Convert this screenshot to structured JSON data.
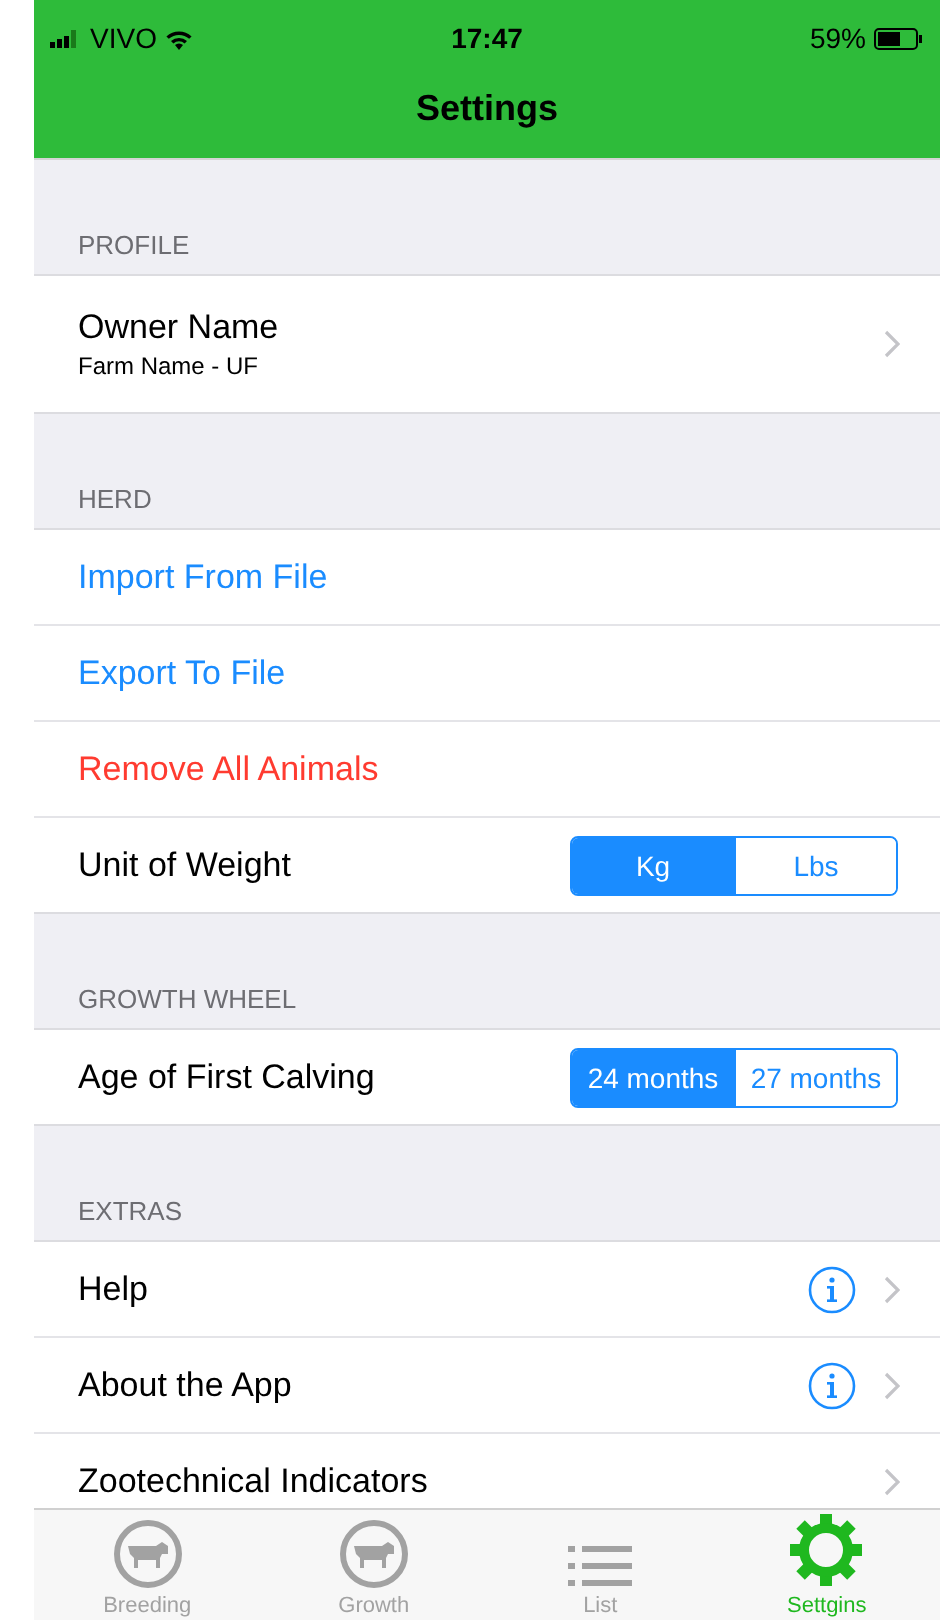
{
  "status_bar": {
    "carrier": "VIVO",
    "time": "17:47",
    "battery": "59%"
  },
  "nav_bar": {
    "title": "Settings"
  },
  "sections": [
    {
      "header": "PROFILE",
      "rows": [
        {
          "kind": "detail",
          "title": "Owner Name",
          "subtitle": "Farm Name - UF"
        }
      ]
    },
    {
      "header": "HERD",
      "rows": [
        {
          "kind": "link",
          "title": "Import From File"
        },
        {
          "kind": "link",
          "title": "Export To File"
        },
        {
          "kind": "destructive",
          "title": "Remove All Animals"
        },
        {
          "kind": "segment",
          "title": "Unit of Weight",
          "options": [
            {
              "label": "Kg",
              "selected": true
            },
            {
              "label": "Lbs",
              "selected": false
            }
          ]
        }
      ]
    },
    {
      "header": "GROWTH WHEEL",
      "rows": [
        {
          "kind": "segment",
          "title": "Age of First Calving",
          "options": [
            {
              "label": "24 months",
              "selected": true
            },
            {
              "label": "27 months",
              "selected": false
            }
          ]
        }
      ]
    },
    {
      "header": "EXTRAS",
      "rows": [
        {
          "kind": "info",
          "title": "Help"
        },
        {
          "kind": "info",
          "title": "About the App"
        },
        {
          "kind": "detail",
          "title": "Zootechnical Indicators"
        }
      ]
    }
  ],
  "tab_bar": [
    {
      "label": "Breeding",
      "kind": "cow",
      "selected": false
    },
    {
      "label": "Growth",
      "kind": "cow",
      "selected": false
    },
    {
      "label": "List",
      "kind": "list",
      "selected": false
    },
    {
      "label": "Settgins",
      "kind": "gear",
      "selected": true
    }
  ]
}
